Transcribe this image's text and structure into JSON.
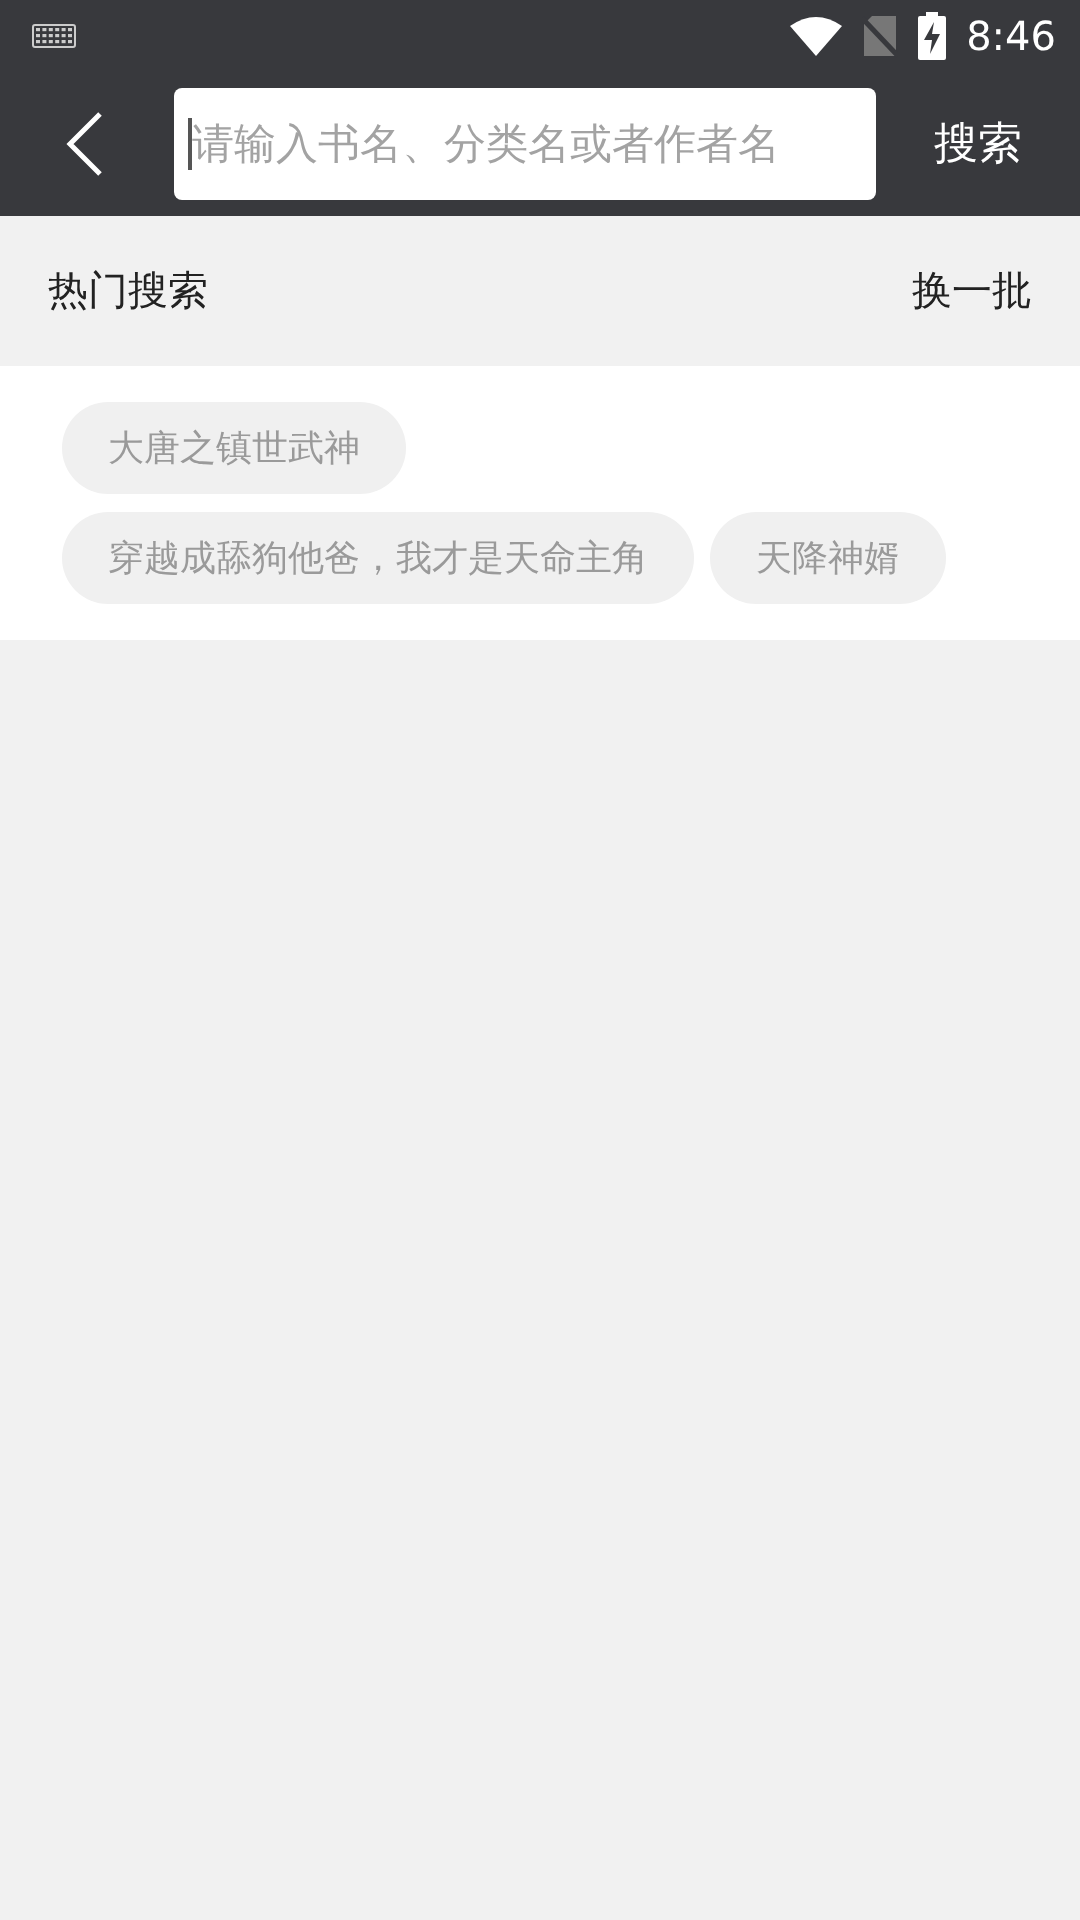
{
  "status_bar": {
    "time": "8:46"
  },
  "header": {
    "search": {
      "placeholder": "请输入书名、分类名或者作者名",
      "focused": true
    },
    "search_button": "搜索"
  },
  "hot_search": {
    "title": "热门搜索",
    "refresh": "换一批",
    "tags": [
      {
        "label": "大唐之镇世武神"
      },
      {
        "label": "穿越成舔狗他爸，我才是天命主角"
      },
      {
        "label": "天降神婿"
      }
    ]
  }
}
